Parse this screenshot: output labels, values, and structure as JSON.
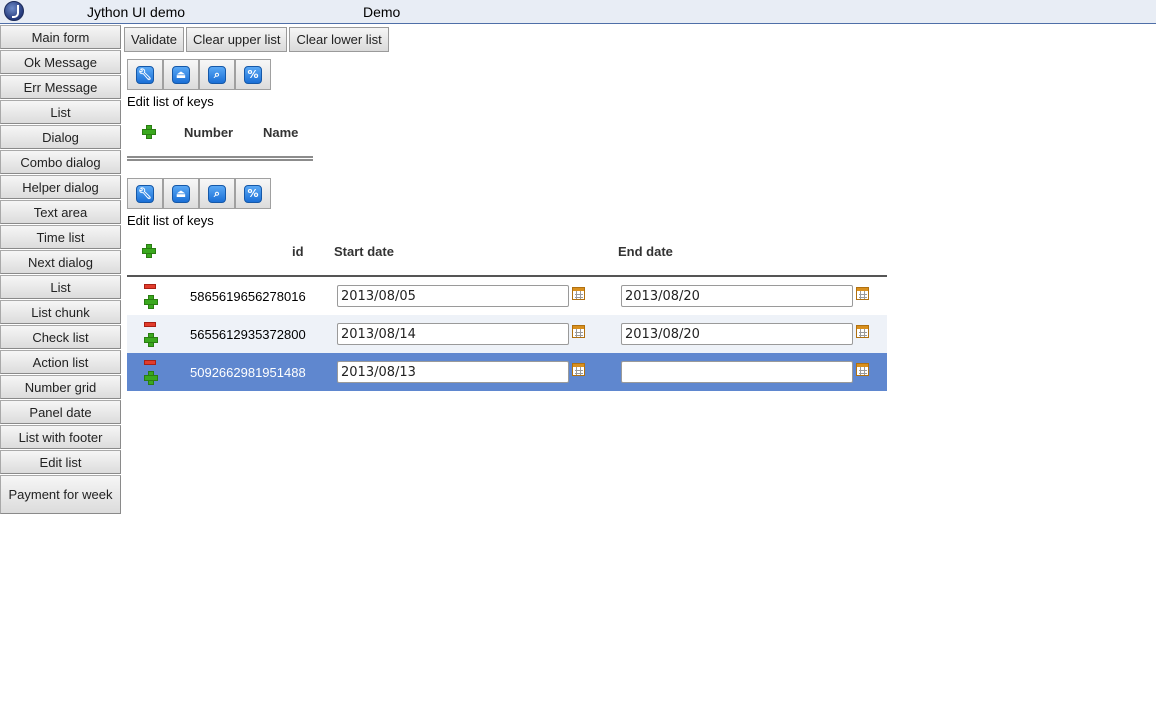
{
  "header": {
    "title": "Jython UI demo",
    "demo": "Demo"
  },
  "sidebar": {
    "items": [
      {
        "label": "Main form"
      },
      {
        "label": "Ok Message"
      },
      {
        "label": "Err Message"
      },
      {
        "label": "List"
      },
      {
        "label": "Dialog"
      },
      {
        "label": "Combo dialog"
      },
      {
        "label": "Helper dialog"
      },
      {
        "label": "Text area"
      },
      {
        "label": "Time list"
      },
      {
        "label": "Next dialog"
      },
      {
        "label": "List"
      },
      {
        "label": "List chunk"
      },
      {
        "label": "Check list"
      },
      {
        "label": "Action list"
      },
      {
        "label": "Number grid"
      },
      {
        "label": "Panel date"
      },
      {
        "label": "List with footer"
      },
      {
        "label": "Edit list"
      },
      {
        "label": "Payment for week"
      }
    ]
  },
  "toolbar": {
    "validate": "Validate",
    "clear_upper": "Clear upper list",
    "clear_lower": "Clear lower list"
  },
  "icons": [
    "wrench-icon",
    "eject-icon",
    "magnifier-icon",
    "percent-icon"
  ],
  "upper": {
    "label": "Edit list of keys",
    "columns": {
      "number": "Number",
      "name": "Name"
    }
  },
  "lower": {
    "label": "Edit list of keys",
    "columns": {
      "id": "id",
      "start": "Start date",
      "end": "End date"
    },
    "rows": [
      {
        "id": "5865619656278016",
        "start": "2013/08/05",
        "end": "2013/08/20"
      },
      {
        "id": "5655612935372800",
        "start": "2013/08/14",
        "end": "2013/08/20"
      },
      {
        "id": "5092662981951488",
        "start": "2013/08/13",
        "end": ""
      }
    ]
  },
  "colors": {
    "selected_row": "#5f87cf",
    "alt_row": "#eef2f8",
    "header_bg": "#e8edf5"
  }
}
